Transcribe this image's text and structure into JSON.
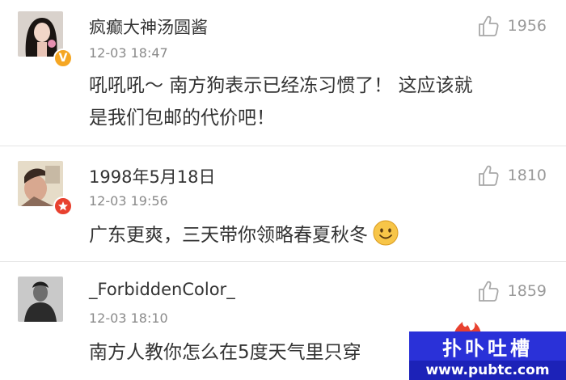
{
  "comments": [
    {
      "username": "疯癫大神汤圆酱",
      "time": "12-03 18:47",
      "likes": "1956",
      "text_line1": "吼吼吼～ 南方狗表示已经冻习惯了！ 这应该就",
      "text_line2": "是我们包邮的代价吧！",
      "badge_icon": "verified-v-icon",
      "badge_color": "#f5a623"
    },
    {
      "username": "1998年5月18日",
      "time": "12-03 19:56",
      "likes": "1810",
      "text_line1": "广东更爽，三天带你领略春夏秋冬",
      "badge_icon": "star-badge-icon",
      "badge_color": "#e8412f"
    },
    {
      "username": "_ForbiddenColor_",
      "time": "12-03 18:10",
      "likes": "1859",
      "text_line1": "南方人教你怎么在5度天气里只穿"
    }
  ],
  "watermark": {
    "title": "扑卟吐槽",
    "url": "www.pubtc.com"
  },
  "colors": {
    "text": "#333333",
    "muted": "#8a8a8a",
    "divider": "#e6e6e6",
    "watermark_blue": "#2a31d8"
  }
}
